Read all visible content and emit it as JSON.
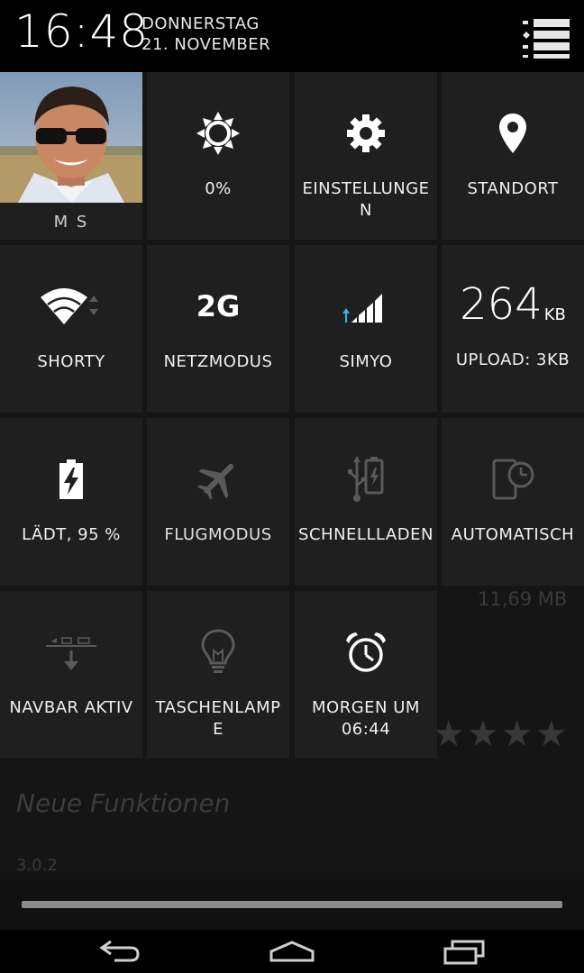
{
  "status": {
    "time": "16:48",
    "weekday": "DONNERSTAG",
    "date": "21. NOVEMBER",
    "menu_icon": "list-settings-icon"
  },
  "background_app": {
    "size_text": "11,69 MB",
    "stars": "★★★★",
    "heading": "Neue Funktionen",
    "version": "3.0.2",
    "progress_fraction": 1.0
  },
  "tiles": [
    {
      "id": "user",
      "label": "M S",
      "icon": "avatar-photo"
    },
    {
      "id": "brightness",
      "label": "0%",
      "icon": "brightness-sun-icon"
    },
    {
      "id": "settings",
      "label": "EINSTELLUNGEN",
      "icon": "gear-icon"
    },
    {
      "id": "location",
      "label": "STANDORT",
      "icon": "location-pin-icon"
    },
    {
      "id": "wifi",
      "label": "SHORTY",
      "icon": "wifi-icon"
    },
    {
      "id": "network-mode",
      "label": "NETZMODUS",
      "icon_text": "2G"
    },
    {
      "id": "mobile",
      "label": "SIMYO",
      "icon": "signal-bars-icon"
    },
    {
      "id": "traffic",
      "label": "UPLOAD: 3KB",
      "value": "264",
      "unit": "KB"
    },
    {
      "id": "battery",
      "label": "LÄDT, 95 %",
      "icon": "battery-charging-icon"
    },
    {
      "id": "airplane",
      "label": "FLUGMODUS",
      "icon": "airplane-icon"
    },
    {
      "id": "fast-charge",
      "label": "SCHNELLLADEN",
      "icon": "usb-charge-icon"
    },
    {
      "id": "auto-rotate",
      "label": "AUTOMATISCH",
      "icon": "phone-timer-icon"
    },
    {
      "id": "navbar",
      "label": "NAVBAR AKTIV",
      "icon": "navbar-icon"
    },
    {
      "id": "flashlight",
      "label": "TASCHENLAMPE",
      "icon": "lightbulb-icon"
    },
    {
      "id": "alarm",
      "label": "MORGEN UM 06:44",
      "icon": "alarm-clock-icon"
    }
  ],
  "nav": {
    "back": "back-icon",
    "home": "home-icon",
    "recents": "recents-icon"
  },
  "colors": {
    "tile_bg": "#1f1f1f",
    "accent_blue": "#33b5e5",
    "inactive_icon": "#5a5a5a"
  }
}
